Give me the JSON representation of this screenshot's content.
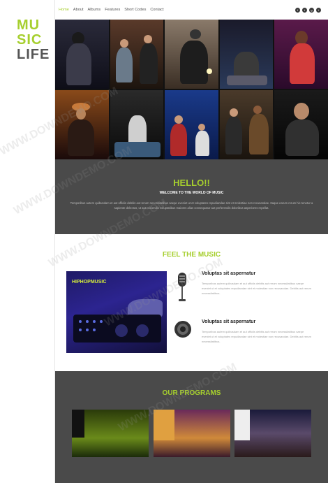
{
  "brand": {
    "line1": "MU",
    "line2": "SIC",
    "line3": "LIFE"
  },
  "nav": {
    "items": [
      {
        "label": "Home",
        "active": true
      },
      {
        "label": "About",
        "active": false
      },
      {
        "label": "Albums",
        "active": false
      },
      {
        "label": "Features",
        "active": false
      },
      {
        "label": "Short Codes",
        "active": false
      },
      {
        "label": "Contact",
        "active": false
      }
    ],
    "social": [
      "facebook-icon",
      "twitter-icon",
      "google-plus-icon",
      "instagram-icon"
    ],
    "social_glyphs": [
      "f",
      "t",
      "g",
      "i"
    ]
  },
  "hello": {
    "title": "HELLO!!",
    "subtitle": "WELCOME TO THE WORLD OF MUSIC",
    "body": "Temporibus autem quibusdam et aut officiis debitis aut rerum necessitatibus saepe eveniet ut et voluptates repudiandae sint et molestiae non recusandae. Itaque earum rerum hic tenetur a sapiente delectus, ut aut reiciendis voluptatibus maiores alias consequatur aut perferendis doloribus asperiores repellat."
  },
  "feel": {
    "title": "FEEL THE MUSIC",
    "card_label": "HIPHOPMUSIC",
    "features": [
      {
        "icon": "microphone-icon",
        "title": "Voluptas sit aspernatur",
        "text": "Temporibus autem quibusdam et aut officiis debitis aut rerum necessitatibus saepe eveniet ut et voluptates repudiandae sint et molestiae non recusandae. Debitis aut rerum necessitatibus."
      },
      {
        "icon": "speaker-icon",
        "title": "Voluptas sit aspernatur",
        "text": "Temporibus autem quibusdam et aut officiis debitis aut rerum necessitatibus saepe eveniet ut et voluptates repudiandae sint et molestiae non recusandae. Debitis aut rerum necessitatibus."
      }
    ]
  },
  "programs": {
    "title": "OUR PROGRAMS"
  },
  "watermark": "WWW.DOWNDEMO.COM",
  "colors": {
    "accent": "#a6cf2e",
    "dark": "#4a4a4a"
  }
}
